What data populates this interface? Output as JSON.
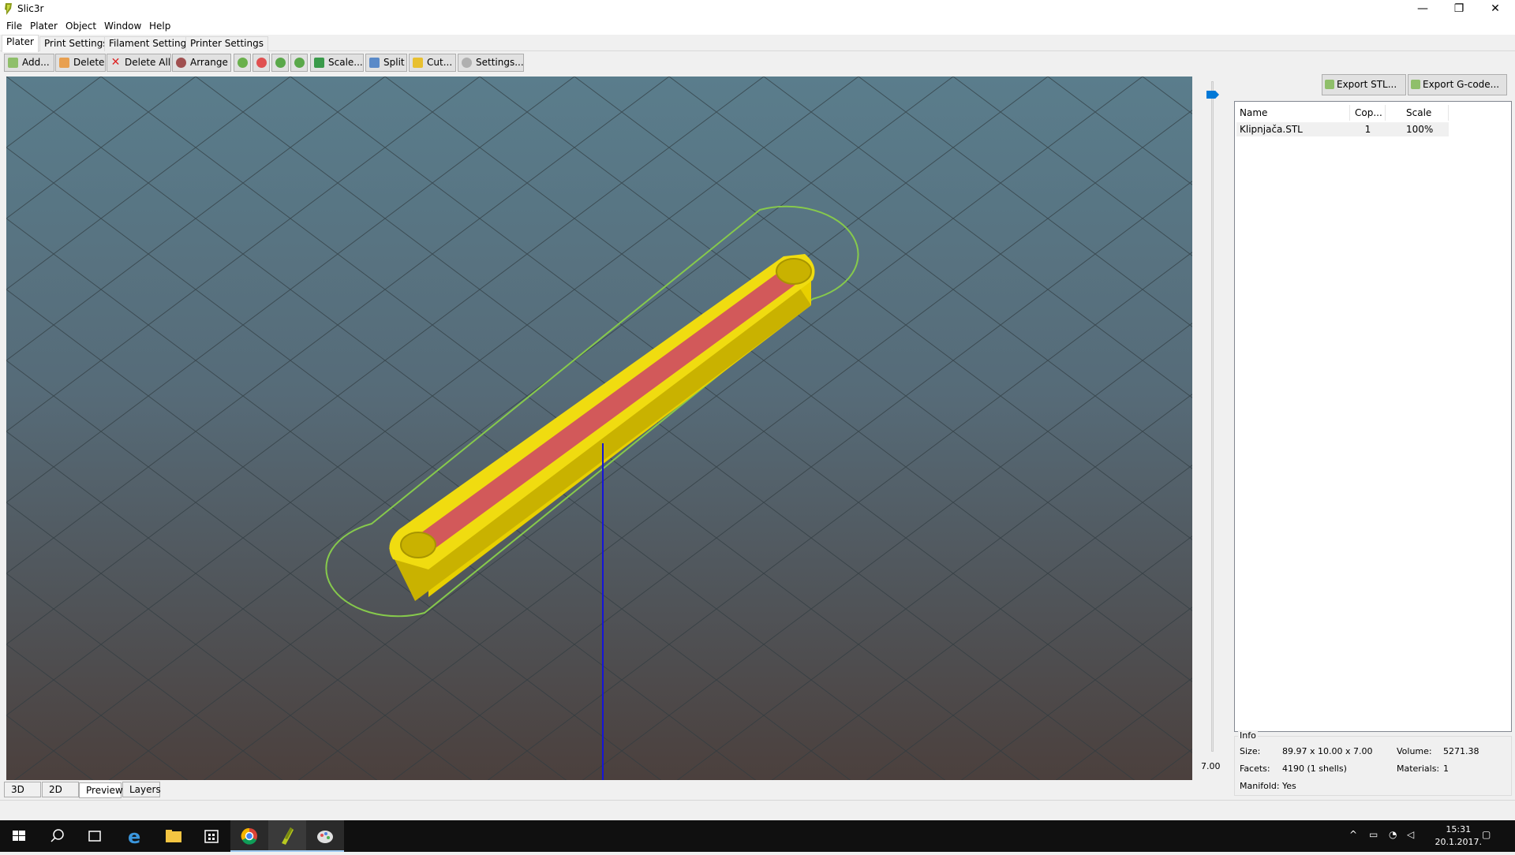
{
  "window": {
    "title": "Slic3r",
    "minimize": "—",
    "restore": "❐",
    "close": "✕"
  },
  "menu": [
    "File",
    "Plater",
    "Object",
    "Window",
    "Help"
  ],
  "tabs": [
    "Plater",
    "Print Settings",
    "Filament Settings",
    "Printer Settings"
  ],
  "toolbar": {
    "add": "Add...",
    "delete": "Delete",
    "delete_all": "Delete All",
    "arrange": "Arrange",
    "split": "Split",
    "scale": "Scale...",
    "cut": "Cut...",
    "settings": "Settings..."
  },
  "layer_slider": {
    "value": "7.00",
    "level": 1.0
  },
  "export": {
    "stl": "Export STL...",
    "gcode": "Export G-code..."
  },
  "object_list": {
    "headers": {
      "name": "Name",
      "copies": "Cop...",
      "scale": "Scale"
    },
    "rows": [
      {
        "name": "Klipnjača.STL",
        "copies": "1",
        "scale": "100%"
      }
    ]
  },
  "info": {
    "title": "Info",
    "size_label": "Size:",
    "size": "89.97 x 10.00 x 7.00",
    "volume_label": "Volume:",
    "volume": "5271.38",
    "facets_label": "Facets:",
    "facets": "4190 (1 shells)",
    "materials_label": "Materials:",
    "materials": "1",
    "manifold_label": "Manifold:",
    "manifold": "Yes"
  },
  "view_tabs": [
    "3D",
    "2D",
    "Preview",
    "Layers"
  ],
  "taskbar": {
    "time": "15:31",
    "date": "20.1.2017."
  },
  "colors": {
    "model": "#e8d000",
    "infill": "#d2595a",
    "skirt": "#86c94c",
    "axis": "#1515d8"
  }
}
